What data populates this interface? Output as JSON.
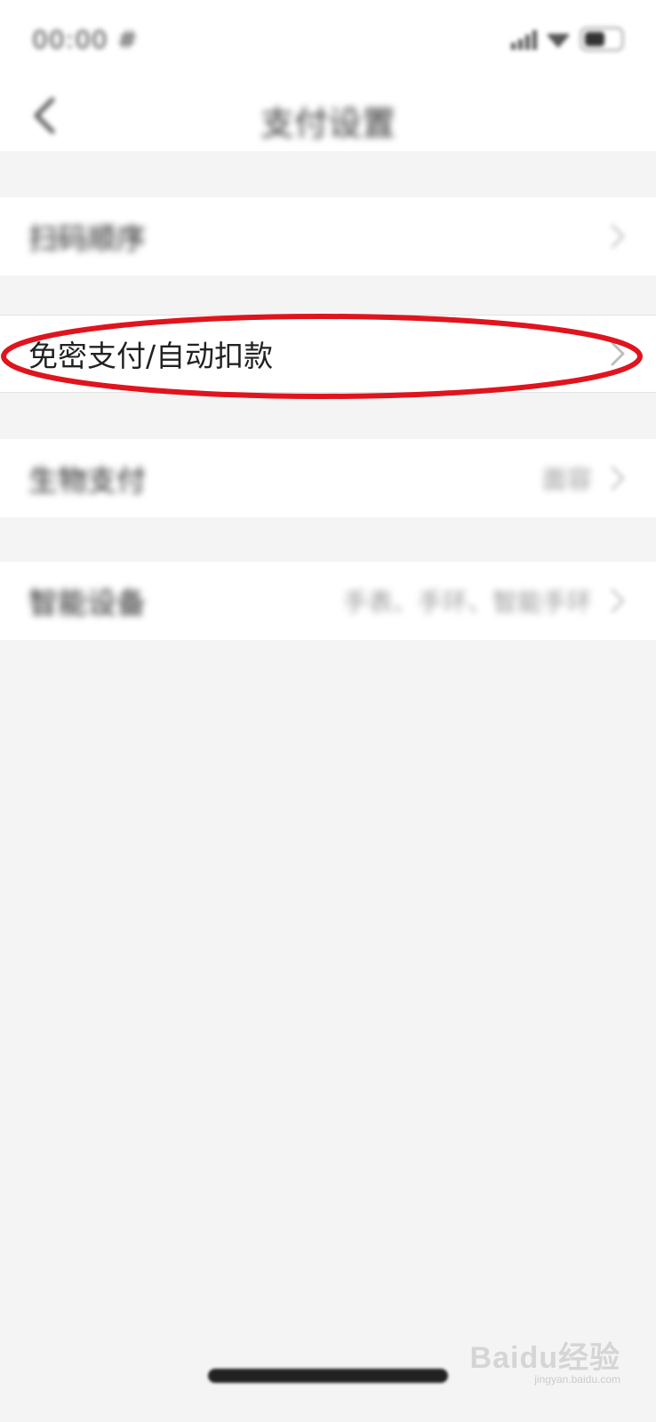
{
  "status_bar": {
    "time": "00:00 #",
    "icons": [
      "signal-icon",
      "wifi-icon",
      "battery-icon"
    ]
  },
  "header": {
    "title": "支付设置",
    "back_icon": "chevron-left-icon"
  },
  "settings": [
    {
      "id": "scan",
      "label": "扫码顺序",
      "value": "",
      "blurred": true
    },
    {
      "id": "nopwd",
      "label": "免密支付/自动扣款",
      "value": "",
      "blurred": false,
      "highlighted": true
    },
    {
      "id": "bio",
      "label": "生物支付",
      "value": "面容",
      "blurred": true
    },
    {
      "id": "smart",
      "label": "智能设备",
      "value": "手表、手环、智能手环",
      "blurred": true
    }
  ],
  "highlight_color": "#e0141e",
  "watermark": {
    "brand": "Baidu经验",
    "url": "jingyan.baidu.com"
  }
}
